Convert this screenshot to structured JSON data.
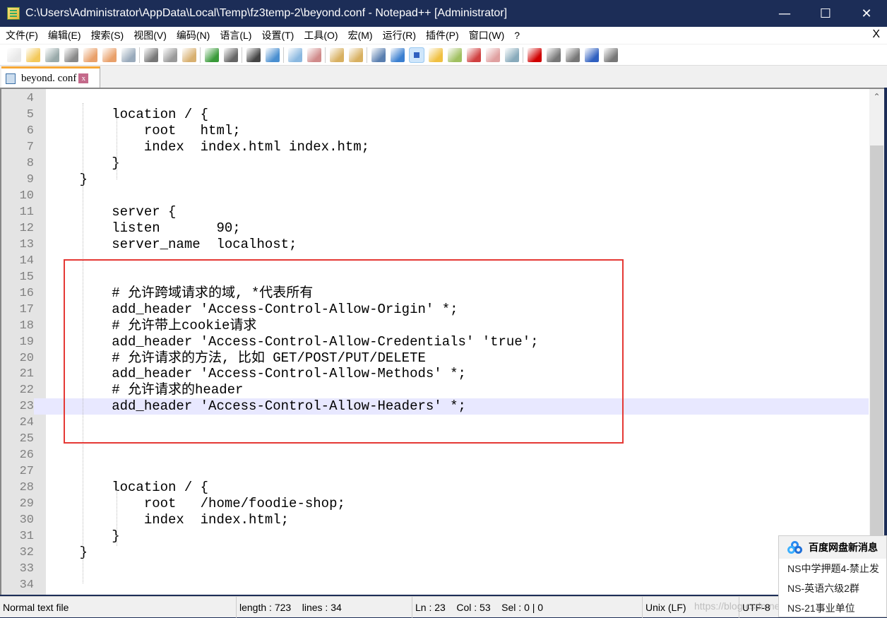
{
  "window": {
    "title": "C:\\Users\\Administrator\\AppData\\Local\\Temp\\fz3temp-2\\beyond.conf - Notepad++ [Administrator]",
    "minimize": "—",
    "maximize": "☐",
    "close": "✕"
  },
  "menu": {
    "items": [
      "文件(F)",
      "编辑(E)",
      "搜索(S)",
      "视图(V)",
      "编码(N)",
      "语言(L)",
      "设置(T)",
      "工具(O)",
      "宏(M)",
      "运行(R)",
      "插件(P)",
      "窗口(W)",
      "?"
    ],
    "close": "X"
  },
  "toolbar": {
    "groups": [
      [
        {
          "icon": "new-file-icon",
          "color": "#e8e8e8"
        },
        {
          "icon": "open-file-icon",
          "color": "#f3c95a"
        },
        {
          "icon": "save-icon",
          "color": "#9aa"
        },
        {
          "icon": "save-all-icon",
          "color": "#888"
        },
        {
          "icon": "close-icon",
          "color": "#e9a06a"
        },
        {
          "icon": "close-all-icon",
          "color": "#e9a06a"
        },
        {
          "icon": "print-icon",
          "color": "#9ab"
        }
      ],
      [
        {
          "icon": "cut-icon",
          "color": "#777"
        },
        {
          "icon": "copy-icon",
          "color": "#999"
        },
        {
          "icon": "paste-icon",
          "color": "#d8b070"
        }
      ],
      [
        {
          "icon": "undo-icon",
          "color": "#3a9a3a"
        },
        {
          "icon": "redo-icon",
          "color": "#666"
        }
      ],
      [
        {
          "icon": "find-icon",
          "color": "#444"
        },
        {
          "icon": "replace-icon",
          "color": "#4a8fd0"
        }
      ],
      [
        {
          "icon": "zoom-in-icon",
          "color": "#8ab8e0"
        },
        {
          "icon": "zoom-out-icon",
          "color": "#d08a8a"
        }
      ],
      [
        {
          "icon": "sync-vertical-icon",
          "color": "#d8b060"
        },
        {
          "icon": "sync-horizontal-icon",
          "color": "#d8b060"
        }
      ],
      [
        {
          "icon": "word-wrap-icon",
          "color": "#5a7fb0"
        },
        {
          "icon": "show-all-chars-icon",
          "color": "#3a7fd0"
        },
        {
          "icon": "indent-guide-icon",
          "color": "#3060c0",
          "selected": true
        },
        {
          "icon": "user-lang-icon",
          "color": "#f0c040"
        },
        {
          "icon": "doc-map-icon",
          "color": "#a0c060"
        },
        {
          "icon": "function-list-icon",
          "color": "#d04040"
        },
        {
          "icon": "folder-workspace-icon",
          "color": "#e0a0a0"
        },
        {
          "icon": "monitoring-icon",
          "color": "#8ab"
        }
      ],
      [
        {
          "icon": "record-macro-icon",
          "color": "#d00000"
        },
        {
          "icon": "stop-macro-icon",
          "color": "#777"
        },
        {
          "icon": "play-macro-icon",
          "color": "#777"
        },
        {
          "icon": "run-macro-multiple-icon",
          "color": "#3060c0"
        },
        {
          "icon": "save-macro-icon",
          "color": "#777"
        }
      ]
    ]
  },
  "tab": {
    "label": "beyond. conf",
    "close": "x"
  },
  "editor": {
    "current_line": 23,
    "lines": [
      {
        "n": "4",
        "t": ""
      },
      {
        "n": "5",
        "t": "        location / {"
      },
      {
        "n": "6",
        "t": "            root   html;"
      },
      {
        "n": "7",
        "t": "            index  index.html index.htm;"
      },
      {
        "n": "8",
        "t": "        }"
      },
      {
        "n": "9",
        "t": "    }"
      },
      {
        "n": "10",
        "t": ""
      },
      {
        "n": "11",
        "t": "        server {"
      },
      {
        "n": "12",
        "t": "        listen       90;"
      },
      {
        "n": "13",
        "t": "        server_name  localhost;"
      },
      {
        "n": "14",
        "t": ""
      },
      {
        "n": "15",
        "t": ""
      },
      {
        "n": "16",
        "t": "        # 允许跨域请求的域, *代表所有"
      },
      {
        "n": "17",
        "t": "        add_header 'Access-Control-Allow-Origin' *;"
      },
      {
        "n": "18",
        "t": "        # 允许带上cookie请求"
      },
      {
        "n": "19",
        "t": "        add_header 'Access-Control-Allow-Credentials' 'true';"
      },
      {
        "n": "20",
        "t": "        # 允许请求的方法, 比如 GET/POST/PUT/DELETE"
      },
      {
        "n": "21",
        "t": "        add_header 'Access-Control-Allow-Methods' *;"
      },
      {
        "n": "22",
        "t": "        # 允许请求的header"
      },
      {
        "n": "23",
        "t": "        add_header 'Access-Control-Allow-Headers' *;"
      },
      {
        "n": "24",
        "t": ""
      },
      {
        "n": "25",
        "t": ""
      },
      {
        "n": "26",
        "t": ""
      },
      {
        "n": "27",
        "t": ""
      },
      {
        "n": "28",
        "t": "        location / {"
      },
      {
        "n": "29",
        "t": "            root   /home/foodie-shop;"
      },
      {
        "n": "30",
        "t": "            index  index.html;"
      },
      {
        "n": "31",
        "t": "        }"
      },
      {
        "n": "32",
        "t": "    }"
      },
      {
        "n": "33",
        "t": ""
      },
      {
        "n": "34",
        "t": ""
      }
    ],
    "highlight_color": "#e53935"
  },
  "status": {
    "type": "Normal text file",
    "length": "length : 723    lines : 34",
    "position": "Ln : 23    Col : 53    Sel : 0 | 0",
    "eol": "Unix (LF)",
    "encoding": "UTF-8"
  },
  "popup": {
    "title": "百度网盘新消息",
    "items": [
      "NS中学押题4-禁止发",
      "NS-英语六级2群",
      "NS-21事业单位"
    ]
  },
  "watermark": "https://blog.csdn.net/...thing"
}
